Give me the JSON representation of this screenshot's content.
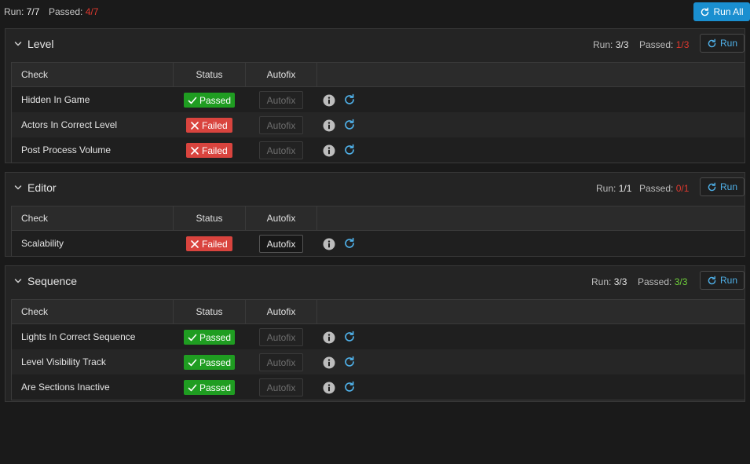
{
  "summary": {
    "run_label": "Run:",
    "run_value": "7/7",
    "passed_label": "Passed:",
    "passed_value": "4/7",
    "run_all_label": "Run All"
  },
  "colors": {
    "accent": "#1a8fd0",
    "passed": "#1f9d21",
    "failed": "#d9443e",
    "fail_text": "#e0392f",
    "pass_text": "#6fcf3a"
  },
  "columns": {
    "check": "Check",
    "status": "Status",
    "autofix": "Autofix"
  },
  "sections": [
    {
      "title": "Level",
      "run_label": "Run:",
      "run_value": "3/3",
      "passed_label": "Passed:",
      "passed_value": "1/3",
      "run_button": "Run",
      "rows": [
        {
          "name": "Hidden In Game",
          "status": "Passed",
          "autofix": "Autofix",
          "autofix_enabled": false
        },
        {
          "name": "Actors In Correct Level",
          "status": "Failed",
          "autofix": "Autofix",
          "autofix_enabled": false
        },
        {
          "name": "Post Process Volume",
          "status": "Failed",
          "autofix": "Autofix",
          "autofix_enabled": false
        }
      ]
    },
    {
      "title": "Editor",
      "run_label": "Run:",
      "run_value": "1/1",
      "passed_label": "Passed:",
      "passed_value": "0/1",
      "run_button": "Run",
      "rows": [
        {
          "name": "Scalability",
          "status": "Failed",
          "autofix": "Autofix",
          "autofix_enabled": true
        }
      ]
    },
    {
      "title": "Sequence",
      "run_label": "Run:",
      "run_value": "3/3",
      "passed_label": "Passed:",
      "passed_value": "3/3",
      "run_button": "Run",
      "rows": [
        {
          "name": "Lights In Correct Sequence",
          "status": "Passed",
          "autofix": "Autofix",
          "autofix_enabled": false
        },
        {
          "name": "Level Visibility Track",
          "status": "Passed",
          "autofix": "Autofix",
          "autofix_enabled": false
        },
        {
          "name": "Are Sections Inactive",
          "status": "Passed",
          "autofix": "Autofix",
          "autofix_enabled": false
        }
      ]
    }
  ]
}
